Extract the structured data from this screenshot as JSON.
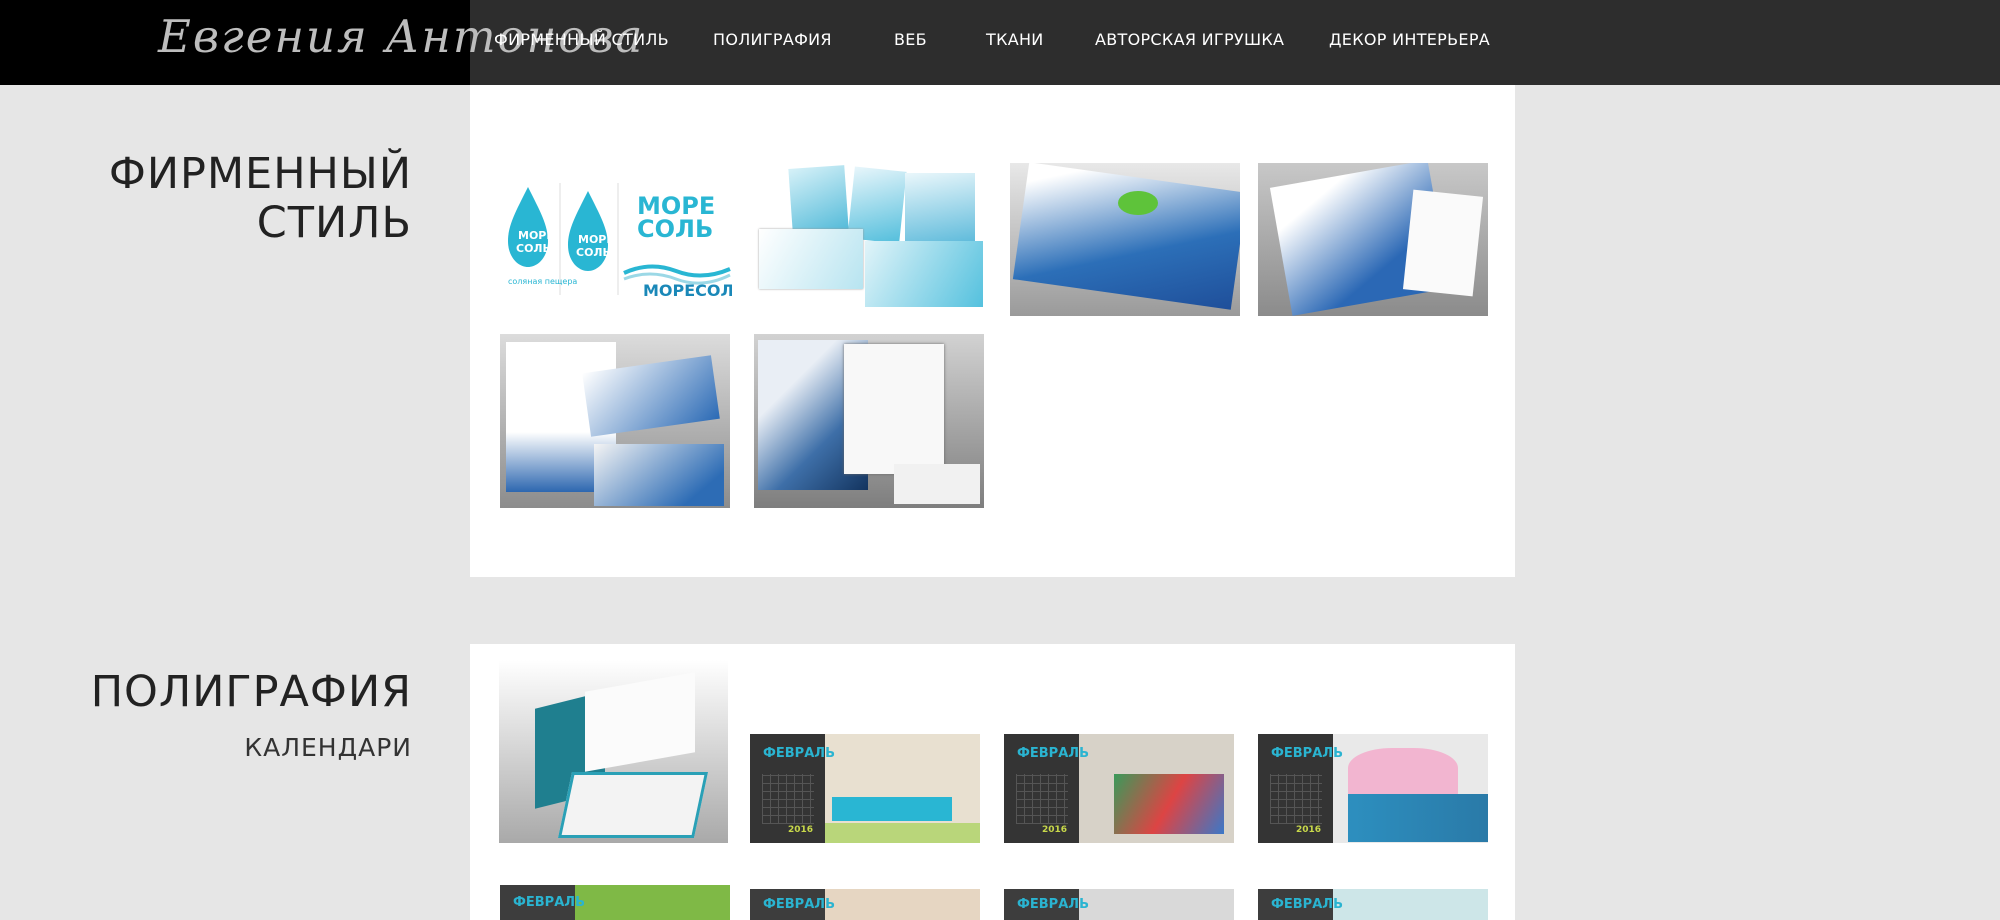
{
  "header": {
    "logo_text": "Евгения Антонова",
    "nav": [
      {
        "label": "ФИРМЕННЫЙ СТИЛЬ"
      },
      {
        "label": "ПОЛИГРАФИЯ"
      },
      {
        "label": "ВЕБ"
      },
      {
        "label": "ТКАНИ"
      },
      {
        "label": "АВТОРСКАЯ ИГРУШКА"
      },
      {
        "label": "ДЕКОР ИНТЕРЬЕРА"
      }
    ]
  },
  "sections": {
    "brand": {
      "title_line1": "ФИРМЕННЫЙ",
      "title_line2": "СТИЛЬ",
      "tiles": {
        "more_sol_top": "МОРЕ",
        "more_sol_bottom": "СОЛЬ",
        "more_sol_caption": "соляная пещера",
        "more_sol_wide": "МОРЕСОЛЬ"
      }
    },
    "print": {
      "title": "ПОЛИГРАФИЯ",
      "subtitle": "КАЛЕНДАРИ",
      "calendar_month": "ФЕВРАЛЬ",
      "calendar_year": "2016"
    }
  },
  "colors": {
    "topbar": "#2d2d2d",
    "logo_bg": "#000000",
    "page_bg": "#e6e6e6",
    "panel_bg": "#ffffff",
    "accent_teal": "#29b6d3",
    "calendar_dark": "#343434"
  }
}
